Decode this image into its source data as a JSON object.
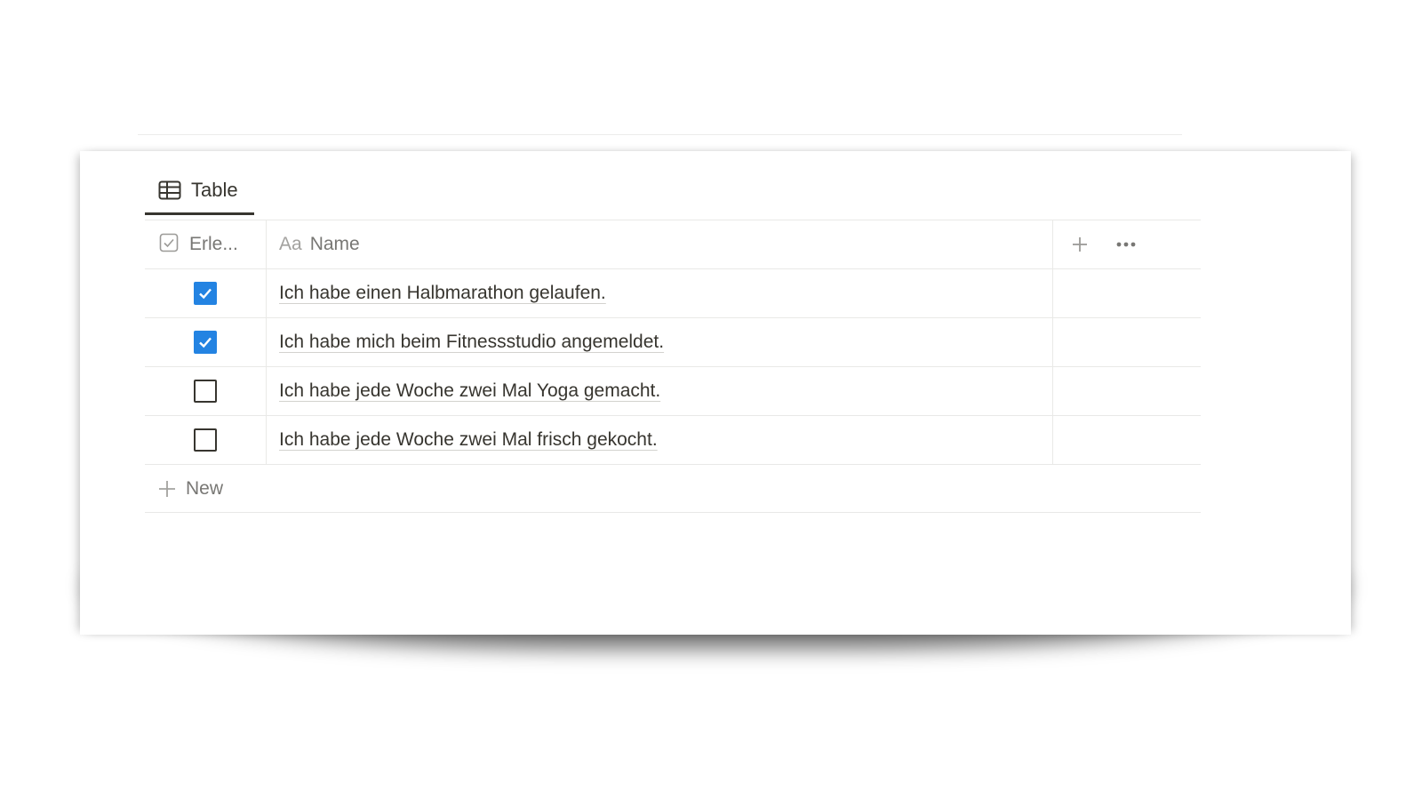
{
  "view": {
    "tab_label": "Table",
    "tab_icon": "table-icon"
  },
  "columns": {
    "done_header": "Erle...",
    "done_icon": "checkbox-property-icon",
    "name_prefix": "Aa",
    "name_header": "Name",
    "add_icon": "plus-icon",
    "more_icon": "more-icon"
  },
  "rows": [
    {
      "done": true,
      "name": "Ich habe einen Halbmarathon gelaufen."
    },
    {
      "done": true,
      "name": "Ich habe mich beim Fitnessstudio angemeldet."
    },
    {
      "done": false,
      "name": "Ich habe jede Woche zwei Mal Yoga gemacht."
    },
    {
      "done": false,
      "name": "Ich habe jede Woche zwei Mal frisch gekocht."
    }
  ],
  "new_row": {
    "label": "New",
    "icon": "plus-icon"
  },
  "colors": {
    "accent": "#2383e2",
    "text": "#37352f",
    "muted": "#787774",
    "border": "#e9e9e7"
  }
}
